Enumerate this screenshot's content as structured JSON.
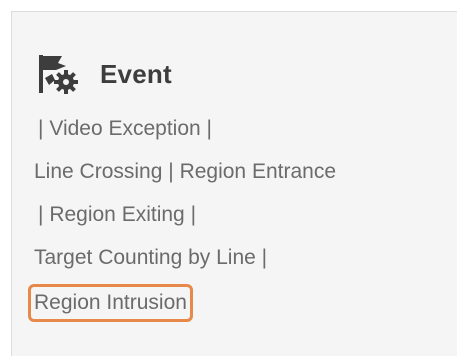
{
  "section": {
    "title": "Event",
    "icon": "flag-gear-icon"
  },
  "links": {
    "video_exception": "Video Exception",
    "line_crossing": "Line Crossing",
    "region_entrance": "Region Entrance",
    "region_exiting": "Region Exiting",
    "target_counting_by_line": "Target Counting by Line",
    "region_intrusion": "Region Intrusion"
  },
  "separator": "|",
  "colors": {
    "text": "#6b6b6b",
    "title": "#3d3d3d",
    "panel_bg": "#f5f5f5",
    "highlight": "#e7894a"
  }
}
